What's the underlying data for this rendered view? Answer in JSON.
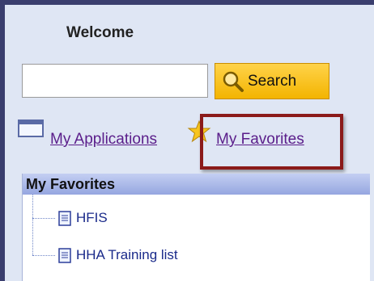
{
  "header": {
    "welcome": "Welcome"
  },
  "search": {
    "value": "",
    "placeholder": "",
    "button_label": "Search"
  },
  "nav": {
    "applications_label": "My Applications",
    "favorites_label": "My Favorites"
  },
  "panel": {
    "title": "My Favorites",
    "items": [
      {
        "label": "HFIS",
        "icon": "document-icon"
      },
      {
        "label": "HHA Training list",
        "icon": "document-icon"
      }
    ]
  },
  "colors": {
    "frame_border": "#3a3e6e",
    "background": "#dfe6f4",
    "search_button": "#f3b400",
    "highlight": "#8b1a1a",
    "link": "#5a1d8a",
    "tree_label": "#1a2a8a"
  }
}
